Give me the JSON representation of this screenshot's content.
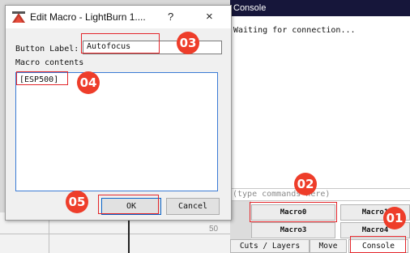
{
  "dialog": {
    "title": "Edit Macro - LightBurn 1....",
    "help_glyph": "?",
    "close_glyph": "×",
    "button_label_caption": "Button Label:",
    "button_label_value": "Autofocus",
    "macro_contents_caption": "Macro contents",
    "macro_contents_value": "[ESP500]",
    "ok_label": "OK",
    "cancel_label": "Cancel"
  },
  "console": {
    "title": "Console",
    "log": "Waiting for connection...",
    "command_placeholder": "(type commands here)",
    "macros": [
      "Macro0",
      "Macro1",
      "Macro3",
      "Macro4"
    ],
    "tabs": [
      "Cuts / Layers",
      "Move",
      "Console"
    ],
    "active_tab": "Console"
  },
  "workspace": {
    "ruler_value": "50"
  },
  "callouts": [
    "01",
    "02",
    "03",
    "04",
    "05"
  ],
  "colors": {
    "highlight": "#e3262b",
    "badge": "#ee3d2a",
    "console_header": "#16163a"
  }
}
